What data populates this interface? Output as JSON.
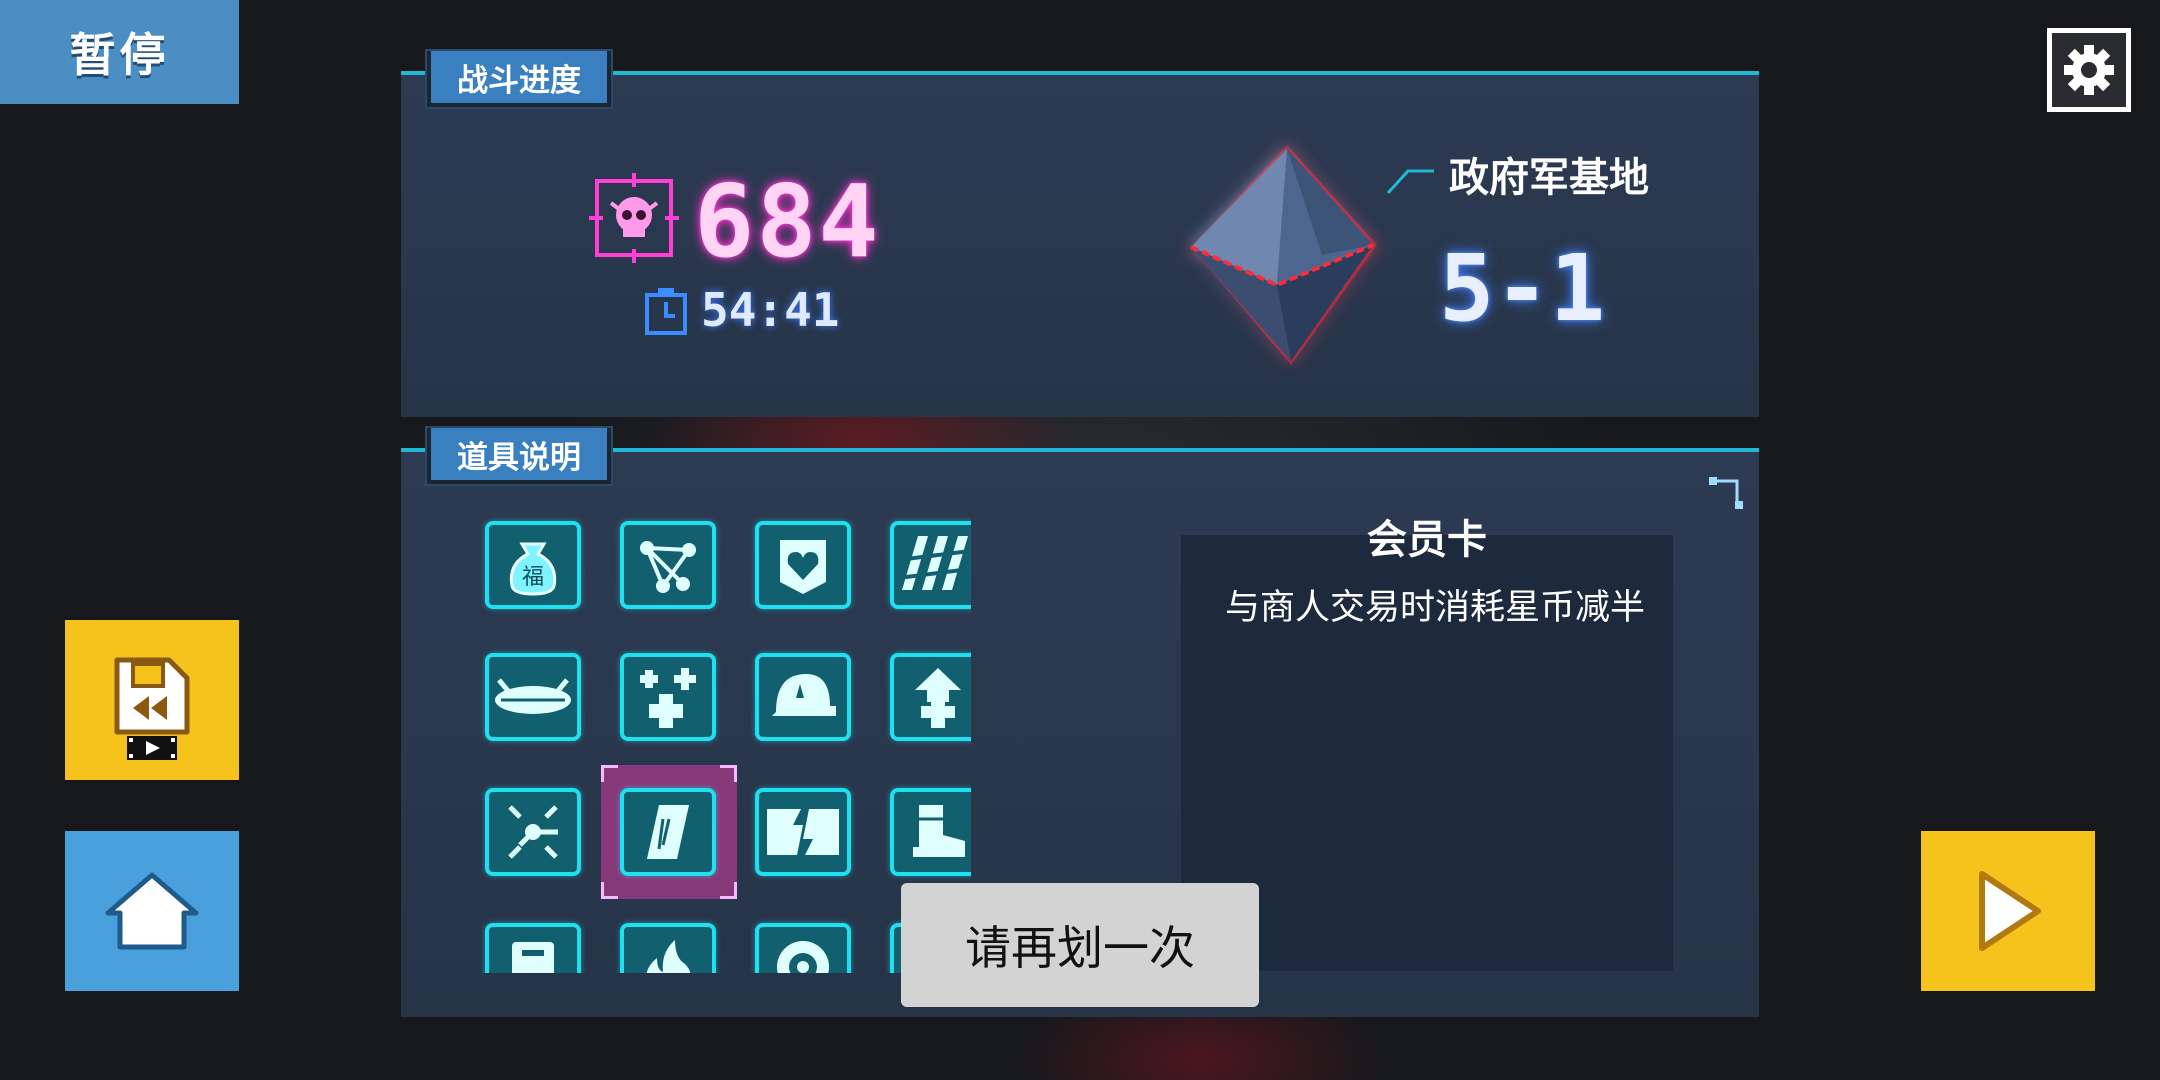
{
  "pause_label": "暂停",
  "battle": {
    "section_label": "战斗进度",
    "kill_count": "684",
    "timer": "54:41",
    "location": "政府军基地",
    "stage": "5-1"
  },
  "items": {
    "section_label": "道具说明",
    "selected_index": 11,
    "grid": [
      {
        "icon": "fortune-bag-icon",
        "glyph": "福"
      },
      {
        "icon": "network-nodes-icon"
      },
      {
        "icon": "heart-shield-icon"
      },
      {
        "icon": "stripes-icon"
      },
      {
        "icon": "chest-icon"
      },
      {
        "icon": "saucer-icon"
      },
      {
        "icon": "plus-cluster-icon"
      },
      {
        "icon": "helmet-icon"
      },
      {
        "icon": "arrow-plus-icon"
      },
      {
        "icon": "cross-circle-icon"
      },
      {
        "icon": "target-split-icon"
      },
      {
        "icon": "membership-card-icon"
      },
      {
        "icon": "broken-block-icon"
      },
      {
        "icon": "boot-icon"
      },
      {
        "icon": "sword-hex-icon"
      },
      {
        "icon": "cabinet-icon"
      },
      {
        "icon": "fire-icon"
      },
      {
        "icon": "wheel-icon"
      },
      {
        "icon": "bar-icon"
      },
      {
        "icon": "bar-icon"
      }
    ],
    "detail_title": "会员卡",
    "detail_text": "与商人交易时消耗星币减半"
  },
  "toast": "请再划一次",
  "colors": {
    "accent": "#23b7d6",
    "item_border": "#1fe0f0",
    "kill_pink": "#ff2fd0",
    "yellow_button": "#f6c21c",
    "blue_button": "#4aa0dc"
  }
}
